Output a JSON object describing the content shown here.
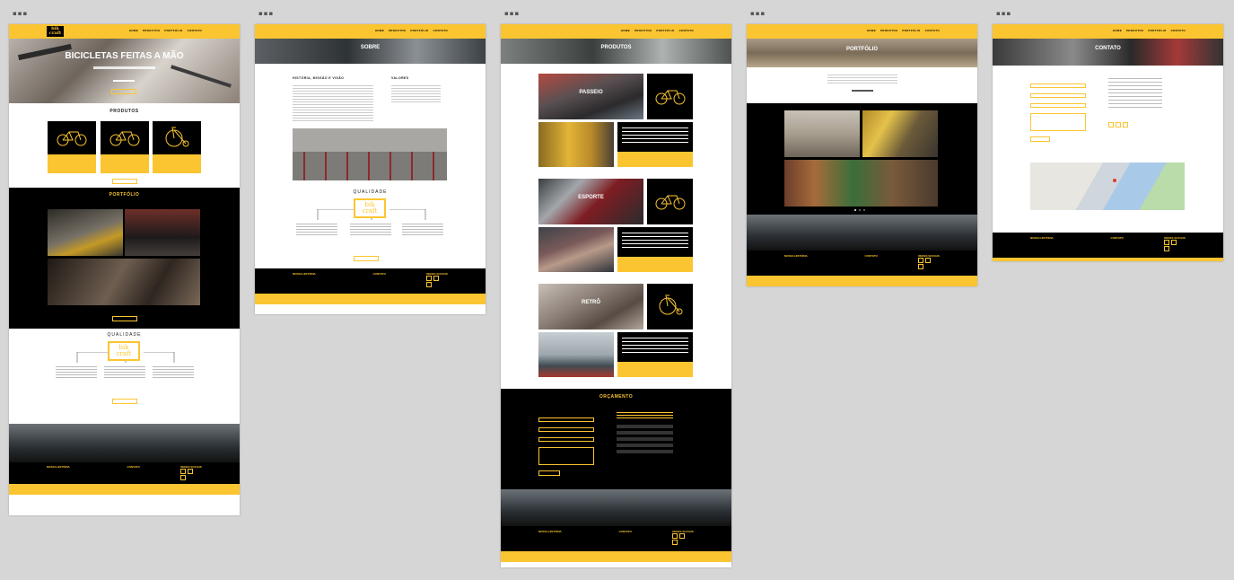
{
  "board_label": "▪▪▪",
  "logo": {
    "line1": "bik",
    "line2": "craft"
  },
  "nav": [
    "HOME",
    "PRODUTOS",
    "PORTFÓLIO",
    "CONTATO"
  ],
  "board1": {
    "hero_title": "BICICLETAS FEITAS A MÃO",
    "produtos_title": "PRODUTOS",
    "portfolio_title": "PORTFÓLIO",
    "qualidade_title": "QUALIDADE",
    "qualidade_logo": {
      "line1": "bik",
      "line2": "craft"
    }
  },
  "board2": {
    "hero_title": "SOBRE",
    "historia_title": "HISTÓRIA, MISSÃO E VISÃO",
    "valores_title": "VALORES",
    "qualidade_title": "QUALIDADE",
    "qualidade_logo": {
      "line1": "bik",
      "line2": "craft"
    }
  },
  "board3": {
    "hero_title": "PRODUTOS",
    "products": [
      "PASSEIO",
      "ESPORTE",
      "RETRÔ"
    ],
    "orcamento_title": "ORÇAMENTO"
  },
  "board4": {
    "hero_title": "PORTFÓLIO"
  },
  "board5": {
    "hero_title": "CONTATO"
  },
  "footer": {
    "col1": "NOSSA HISTÓRIA",
    "col2": "CONTATO",
    "col3": "REDES SOCIAIS"
  },
  "colors": {
    "accent": "#fbc531",
    "dark": "#000000"
  }
}
